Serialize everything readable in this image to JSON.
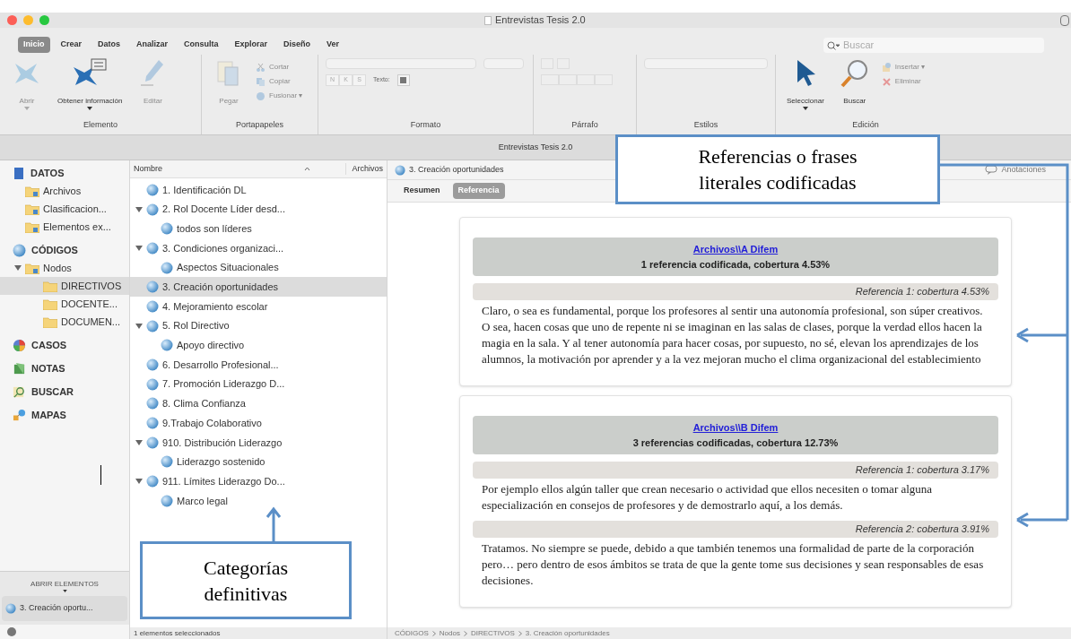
{
  "window": {
    "title": "Entrevistas Tesis 2.0"
  },
  "ribbon_tabs": [
    {
      "label": "Inicio",
      "selected": true
    },
    {
      "label": "Crear",
      "selected": false
    },
    {
      "label": "Datos",
      "selected": false
    },
    {
      "label": "Analizar",
      "selected": false
    },
    {
      "label": "Consulta",
      "selected": false
    },
    {
      "label": "Explorar",
      "selected": false
    },
    {
      "label": "Diseño",
      "selected": false
    },
    {
      "label": "Ver",
      "selected": false
    }
  ],
  "search": {
    "placeholder": "Buscar"
  },
  "ribbon_groups": [
    {
      "label": "Elemento",
      "items": [
        {
          "kind": "large",
          "label": "Abrir",
          "disabled": true,
          "menu": true
        },
        {
          "kind": "large",
          "label": "Obtener información",
          "disabled": false,
          "menu": true
        },
        {
          "kind": "large",
          "label": "Editar",
          "disabled": true,
          "menu": false
        }
      ]
    },
    {
      "label": "Portapapeles",
      "items": [
        {
          "kind": "large",
          "label": "Pegar",
          "disabled": true,
          "menu": false
        },
        {
          "kind": "small",
          "label": "Cortar",
          "disabled": true
        },
        {
          "kind": "small",
          "label": "Copiar",
          "disabled": true
        },
        {
          "kind": "small",
          "label": "Fusionar ▾",
          "disabled": true
        }
      ]
    },
    {
      "label": "Formato",
      "items": [
        {
          "kind": "format",
          "buttons": [
            "N",
            "K",
            "S"
          ],
          "color_label": "Texto:"
        }
      ]
    },
    {
      "label": "Párrafo",
      "items": [
        {
          "kind": "paragraph"
        }
      ]
    },
    {
      "label": "Estilos",
      "items": [
        {
          "kind": "select"
        }
      ]
    },
    {
      "label": "Edición",
      "items": [
        {
          "kind": "large",
          "label": "Seleccionar",
          "disabled": false,
          "menu": true
        },
        {
          "kind": "large",
          "label": "Buscar",
          "disabled": false,
          "menu": false
        },
        {
          "kind": "small",
          "label": "Insertar ▾",
          "disabled": true
        },
        {
          "kind": "small",
          "label": "Eliminar",
          "disabled": true
        }
      ]
    }
  ],
  "project_bar": {
    "title": "Entrevistas Tesis 2.0"
  },
  "navigation": [
    {
      "label": "DATOS",
      "children": [
        {
          "label": "Archivos",
          "selected": false
        },
        {
          "label": "Clasificacion...",
          "selected": false
        },
        {
          "label": "Elementos ex...",
          "selected": false
        }
      ]
    },
    {
      "label": "CÓDIGOS",
      "children": [
        {
          "label": "Nodos",
          "selected": false,
          "expanded": true,
          "children": [
            {
              "label": "DIRECTIVOS",
              "selected": true
            },
            {
              "label": "DOCENTE...",
              "selected": false
            },
            {
              "label": "DOCUMEN...",
              "selected": false
            }
          ]
        }
      ]
    },
    {
      "label": "CASOS"
    },
    {
      "label": "NOTAS"
    },
    {
      "label": "BUSCAR"
    },
    {
      "label": "MAPAS"
    }
  ],
  "open_items": {
    "label": "ABRIR ELEMENTOS",
    "items": [
      "3. Creación oportu..."
    ]
  },
  "node_list": {
    "columns": [
      "Nombre",
      "Archivos"
    ],
    "nodes": [
      {
        "label": "1. Identificación DL",
        "selected": false
      },
      {
        "label": "2. Rol Docente Líder desd...",
        "selected": false,
        "expanded": true,
        "children": [
          {
            "label": "todos son líderes",
            "selected": false
          }
        ]
      },
      {
        "label": "3. Condiciones organizaci...",
        "selected": false,
        "expanded": true,
        "children": [
          {
            "label": "Aspectos Situacionales",
            "selected": false
          }
        ]
      },
      {
        "label": "3. Creación oportunidades",
        "selected": true
      },
      {
        "label": "4. Mejoramiento escolar",
        "selected": false
      },
      {
        "label": "5. Rol Directivo",
        "selected": false,
        "expanded": true,
        "children": [
          {
            "label": "Apoyo directivo",
            "selected": false
          }
        ]
      },
      {
        "label": "6. Desarrollo Profesional...",
        "selected": false
      },
      {
        "label": "7. Promoción Liderazgo D...",
        "selected": false
      },
      {
        "label": "8. Clima Confianza",
        "selected": false
      },
      {
        "label": "9.Trabajo Colaborativo",
        "selected": false
      },
      {
        "label": "910. Distribución Liderazgo",
        "selected": false,
        "expanded": true,
        "children": [
          {
            "label": "Liderazgo sostenido",
            "selected": false
          }
        ]
      },
      {
        "label": "911. Límites Liderazgo Do...",
        "selected": false,
        "expanded": true,
        "children": [
          {
            "label": "Marco legal",
            "selected": false
          }
        ]
      }
    ],
    "status": "1 elementos seleccionados"
  },
  "detail": {
    "tab": "3. Creación oportunidades",
    "annotations": "Anotaciones",
    "view_tabs": [
      {
        "label": "Resumen",
        "selected": false
      },
      {
        "label": "Referencia",
        "selected": true
      }
    ],
    "sources": [
      {
        "link": "Archivos\\\\A Difem",
        "summary": "1 referencia codificada, cobertura 4.53%",
        "references": [
          {
            "header": "Referencia 1: cobertura 4.53%",
            "text": "Claro, o sea es fundamental, porque los profesores al sentir una autonomía profesional, son súper creativos. O sea, hacen cosas que uno de repente ni se imaginan en las salas de clases, porque la verdad ellos hacen la magia en la sala. Y al tener autonomía para hacer cosas, por supuesto, no sé, elevan los aprendizajes de los alumnos, la motivación por aprender y a la vez mejoran mucho el clima organizacional del establecimiento"
          }
        ]
      },
      {
        "link": "Archivos\\\\B Difem",
        "summary": "3 referencias codificadas, cobertura 12.73%",
        "references": [
          {
            "header": "Referencia 1: cobertura 3.17%",
            "text": "Por ejemplo ellos algún taller que crean necesario o actividad que ellos necesiten o tomar alguna especialización en consejos de profesores y de demostrarlo aquí, a los demás."
          },
          {
            "header": "Referencia 2: cobertura 3.91%",
            "text": "Tratamos. No siempre se puede, debido a que también tenemos una formalidad de parte de la corporación pero… pero dentro de esos ámbitos se trata de que la gente tome sus decisiones y sean responsables de esas decisiones."
          }
        ]
      }
    ],
    "breadcrumb": [
      "CÓDIGOS",
      "Nodos",
      "DIRECTIVOS",
      "3. Creación oportunidades"
    ]
  },
  "callouts": [
    {
      "kind": "references",
      "text": "Referencias o frases literales codificadas"
    },
    {
      "kind": "categories",
      "text": "Categorías definitivas"
    }
  ]
}
